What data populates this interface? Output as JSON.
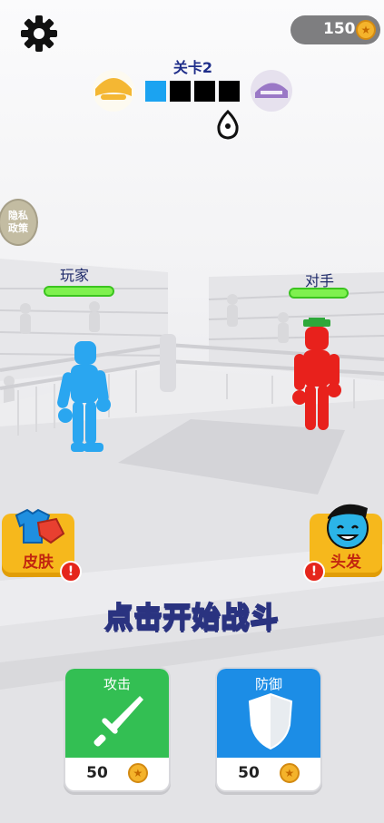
{
  "coins": "150",
  "level": {
    "title": "关卡2",
    "segments_total": 4,
    "segments_done": 1
  },
  "privacy": {
    "label_line1": "隐私",
    "label_line2": "政策"
  },
  "player": {
    "name": "玩家",
    "health": 1.0
  },
  "opponent": {
    "name": "对手",
    "health": 1.0
  },
  "side_buttons": {
    "skin": "皮肤",
    "hair": "头发",
    "alert": "!"
  },
  "tap_to_start": "点击开始战斗",
  "upgrades": [
    {
      "title": "攻击",
      "price": "50",
      "color": "#33bf53",
      "icon": "sword-icon"
    },
    {
      "title": "防御",
      "price": "50",
      "color": "#1c8de6",
      "icon": "shield-icon"
    }
  ],
  "colors": {
    "player": "#2aa6f0",
    "opponent": "#e8211c",
    "hp": "#7ff14f",
    "prog_done": "#1ba3f1",
    "prog_todo": "#000000"
  }
}
